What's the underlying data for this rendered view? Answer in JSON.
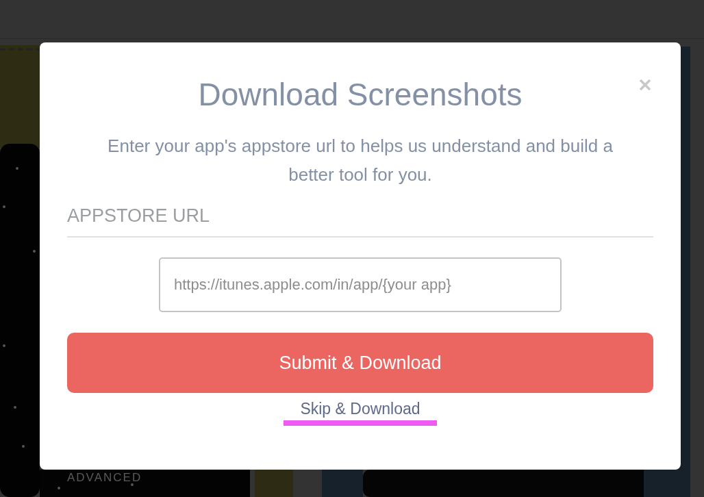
{
  "background": {
    "label": "ADVANCED"
  },
  "dialog": {
    "title": "Download Screenshots",
    "description": "Enter your app's appstore url to helps us understand and build a better tool for you.",
    "field_label": "APPSTORE URL",
    "url_field": {
      "placeholder": "https://itunes.apple.com/in/app/{your app}"
    },
    "submit_button": "Submit & Download",
    "skip_link": "Skip & Download"
  }
}
